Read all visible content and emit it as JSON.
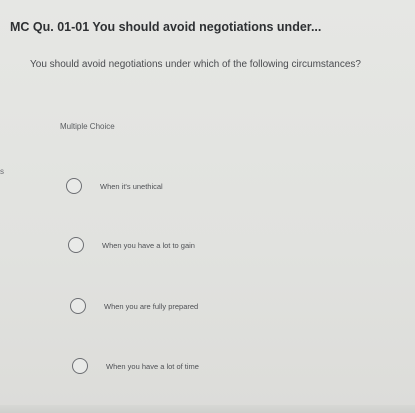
{
  "question_header": {
    "title": "MC Qu. 01-01 You should avoid negotiations under..."
  },
  "question": {
    "text": "You should avoid negotiations under which of the following circumstances?",
    "type_label": "Multiple Choice",
    "edge_fragment": "s"
  },
  "options": [
    {
      "label": "When it's unethical",
      "selected": false
    },
    {
      "label": "When you have a lot to gain",
      "selected": false
    },
    {
      "label": "When you are fully prepared",
      "selected": false
    },
    {
      "label": "When you have a lot of time",
      "selected": false
    }
  ]
}
